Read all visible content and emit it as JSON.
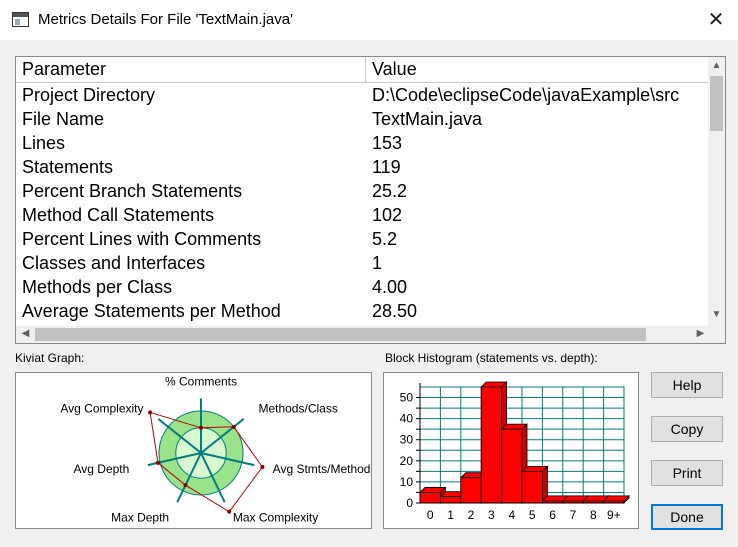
{
  "window": {
    "title": "Metrics Details For File 'TextMain.java'",
    "close_glyph": "✕"
  },
  "table": {
    "headers": {
      "parameter": "Parameter",
      "value": "Value"
    },
    "rows": [
      {
        "parameter": "Project Directory",
        "value": "D:\\Code\\eclipseCode\\javaExample\\src"
      },
      {
        "parameter": "File Name",
        "value": "TextMain.java"
      },
      {
        "parameter": "Lines",
        "value": "153"
      },
      {
        "parameter": "Statements",
        "value": "119"
      },
      {
        "parameter": "Percent Branch Statements",
        "value": "25.2"
      },
      {
        "parameter": "Method Call Statements",
        "value": "102"
      },
      {
        "parameter": "Percent Lines with Comments",
        "value": "5.2"
      },
      {
        "parameter": "Classes and Interfaces",
        "value": "1"
      },
      {
        "parameter": "Methods per Class",
        "value": "4.00"
      },
      {
        "parameter": "Average Statements per Method",
        "value": "28.50"
      }
    ],
    "scroll_up": "▲",
    "scroll_down": "▼",
    "scroll_left": "◀",
    "scroll_right": "▶"
  },
  "kiviat": {
    "label": "Kiviat Graph:",
    "axes": [
      "% Comments",
      "Methods/Class",
      "Avg Stmts/Method",
      "Max Complexity",
      "Max Depth",
      "Avg Depth",
      "Avg Complexity"
    ],
    "values": [
      0.6,
      1.0,
      1.5,
      1.55,
      0.85,
      1.05,
      1.55
    ],
    "colors": {
      "outer_band": "#9be38a",
      "inner_band": "#d8f8d0",
      "axis": "#007d7d",
      "profile": "#c00000",
      "marker": "#8b0000"
    }
  },
  "histogram": {
    "label": "Block Histogram (statements vs. depth):",
    "chart_data": {
      "type": "bar",
      "title": "Block Histogram (statements vs. depth):",
      "categories": [
        "0",
        "1",
        "2",
        "3",
        "4",
        "5",
        "6",
        "7",
        "8",
        "9+"
      ],
      "values": [
        5,
        3,
        12,
        55,
        35,
        15,
        1,
        1,
        1,
        1
      ],
      "y_ticks": [
        "0",
        "5",
        "10",
        "15",
        "20",
        "25",
        "30",
        "35",
        "40",
        "45",
        "50"
      ],
      "ylim": [
        0,
        55
      ],
      "bar_color": "#ff0000",
      "grid_color": "#007d7d"
    }
  },
  "buttons": {
    "help": "Help",
    "copy": "Copy",
    "print": "Print",
    "done": "Done"
  }
}
